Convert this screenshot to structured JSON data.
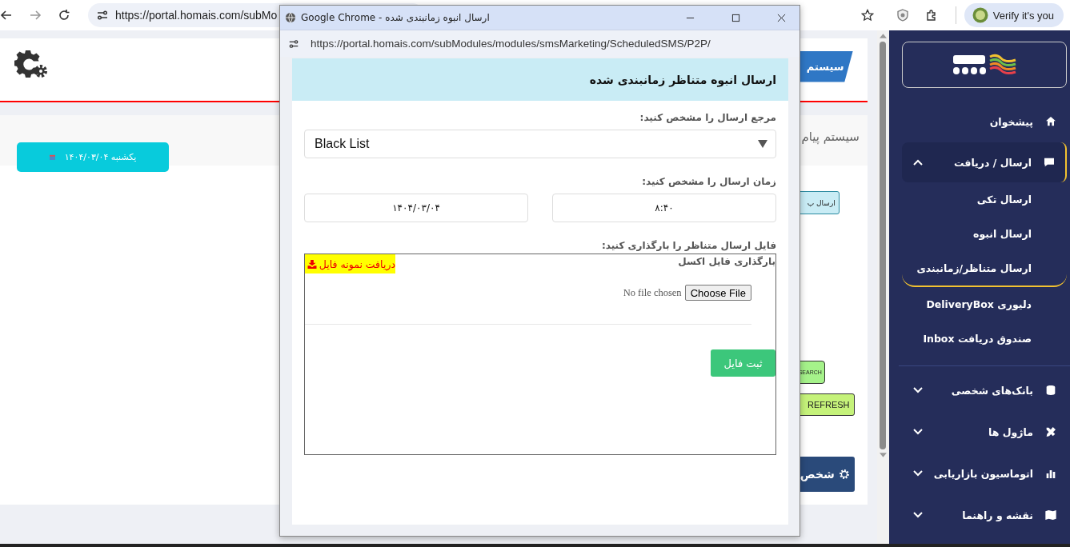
{
  "browser": {
    "address": "https://portal.homais.com/subMo",
    "profile_button": "Verify it's you"
  },
  "page": {
    "header_tab": "سیستم",
    "breadcrumb": "سیستم پیام",
    "date_button": "یکشنبه ۱۴۰۴/۰۳/۰۴",
    "send_button": "ارسال پ",
    "search_button": "SEARCH",
    "refresh_button": "REFRESH",
    "settings_button": "شخص"
  },
  "sidebar": {
    "items": [
      {
        "kind": "link",
        "label": "پیشخوان"
      },
      {
        "kind": "group",
        "label": "ارسال / دریافت",
        "expanded": true,
        "children": [
          {
            "label": "ارسال تکی",
            "selected": false
          },
          {
            "label": "ارسال انبوه",
            "selected": false
          },
          {
            "label": "ارسال متناظر/زمانبندی",
            "selected": true
          },
          {
            "label": "دلیوری DeliveryBox",
            "selected": false
          },
          {
            "label": "صندوق دریافت Inbox",
            "selected": false
          }
        ]
      },
      {
        "kind": "group",
        "label": "بانک‌های شخصی",
        "expanded": false
      },
      {
        "kind": "group",
        "label": "ماژول ها",
        "expanded": false
      },
      {
        "kind": "group",
        "label": "اتوماسیون بازاریابی",
        "expanded": false
      },
      {
        "kind": "group",
        "label": "نقشه و راهنما",
        "expanded": false
      }
    ]
  },
  "popup": {
    "title": "Google Chrome - ارسال انبوه زمانبندی شده",
    "url": "https://portal.homais.com/subModules/modules/smsMarketing/ScheduledSMS/P2P/",
    "heading": "ارسال انبوه متناظر زمانبندی شده",
    "source_label": "مرجع ارسال را مشخص کنید:",
    "source_value": "Black List",
    "time_label": "زمان ارسال را مشخص کنید:",
    "date_value": "۱۴۰۴/۰۳/۰۴",
    "time_value": "۸:۴۰",
    "file_label": "فایل ارسال متناظر را بارگذاری کنید:",
    "upload_title": "بارگذاری فایل اکسل",
    "sample_link": "دریافت نمونه فایل",
    "choose_button": "Choose File",
    "file_status": "No file chosen",
    "submit_button": "ثبت فایل"
  }
}
